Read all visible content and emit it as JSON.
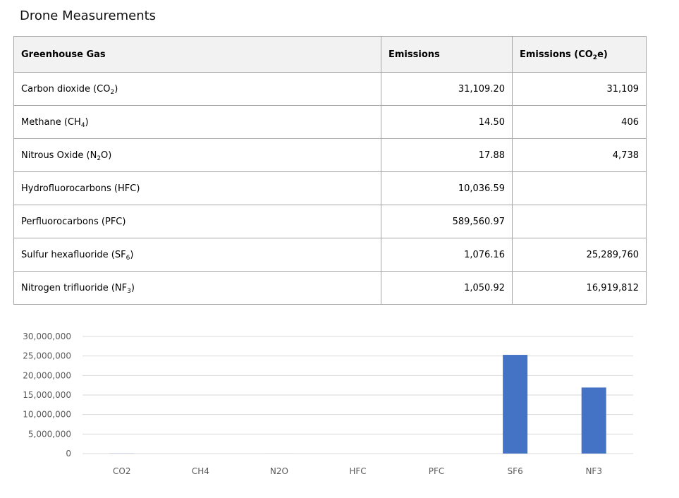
{
  "title": "Drone Measurements",
  "table": {
    "headers": {
      "gas": "Greenhouse Gas",
      "emissions": "Emissions",
      "co2e_pre": "Emissions (CO",
      "co2e_sub": "2",
      "co2e_post": "e)"
    },
    "rows": [
      {
        "name_pre": "Carbon dioxide (CO",
        "name_sub": "2",
        "name_post": ")",
        "emissions": "31,109.20",
        "co2e": "31,109"
      },
      {
        "name_pre": "Methane (CH",
        "name_sub": "4",
        "name_post": ")",
        "emissions": "14.50",
        "co2e": "406"
      },
      {
        "name_pre": "Nitrous Oxide (N",
        "name_sub": "2",
        "name_post": "O)",
        "emissions": "17.88",
        "co2e": "4,738"
      },
      {
        "name_pre": "Hydrofluorocarbons (HFC)",
        "name_sub": "",
        "name_post": "",
        "emissions": "10,036.59",
        "co2e": ""
      },
      {
        "name_pre": "Perfluorocarbons (PFC)",
        "name_sub": "",
        "name_post": "",
        "emissions": "589,560.97",
        "co2e": ""
      },
      {
        "name_pre": "Sulfur hexafluoride (SF",
        "name_sub": "6",
        "name_post": ")",
        "emissions": "1,076.16",
        "co2e": "25,289,760"
      },
      {
        "name_pre": "Nitrogen trifluoride (NF",
        "name_sub": "3",
        "name_post": ")",
        "emissions": "1,050.92",
        "co2e": "16,919,812"
      }
    ]
  },
  "chart_data": {
    "type": "bar",
    "categories": [
      "CO2",
      "CH4",
      "N2O",
      "HFC",
      "PFC",
      "SF6",
      "NF3"
    ],
    "values": [
      31109,
      406,
      4738,
      0,
      0,
      25289760,
      16919812
    ],
    "ylim": [
      0,
      30000000
    ],
    "yticks": [
      0,
      5000000,
      10000000,
      15000000,
      20000000,
      25000000,
      30000000
    ],
    "ytick_labels": [
      "0",
      "5,000,000",
      "10,000,000",
      "15,000,000",
      "20,000,000",
      "25,000,000",
      "30,000,000"
    ],
    "bar_color": "#4472c4",
    "grid_color": "#d9d9d9",
    "grid": true
  }
}
